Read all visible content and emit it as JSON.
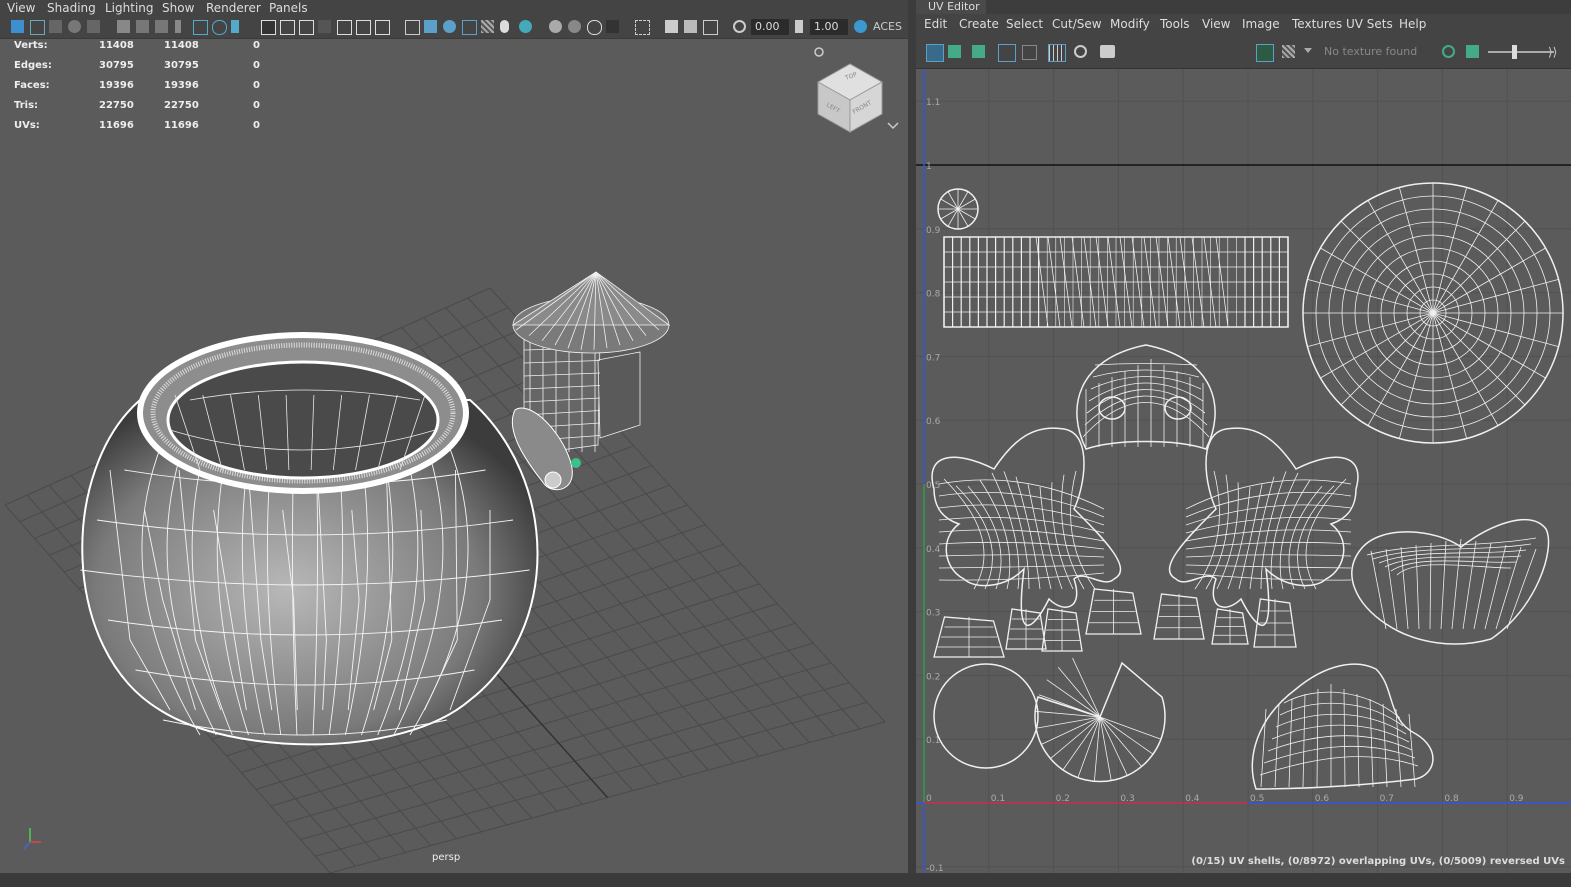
{
  "viewport": {
    "menu": [
      "View",
      "Shading",
      "Lighting",
      "Show",
      "Renderer",
      "Panels"
    ],
    "toolbar": {
      "exposure": "0.00",
      "gamma": "1.00",
      "color_space": "ACES"
    },
    "hud": {
      "rows": [
        {
          "label": "Verts:",
          "a": "11408",
          "b": "11408",
          "c": "0"
        },
        {
          "label": "Edges:",
          "a": "30795",
          "b": "30795",
          "c": "0"
        },
        {
          "label": "Faces:",
          "a": "19396",
          "b": "19396",
          "c": "0"
        },
        {
          "label": "Tris:",
          "a": "22750",
          "b": "22750",
          "c": "0"
        },
        {
          "label": "UVs:",
          "a": "11696",
          "b": "11696",
          "c": "0"
        }
      ]
    },
    "viewcube": {
      "top": "TOP",
      "left": "LEFT",
      "front": "FRONT"
    },
    "camera_label": "persp"
  },
  "uv_editor": {
    "tab_title": "UV Editor",
    "menu": [
      "Edit",
      "Create",
      "Select",
      "Cut/Sew",
      "Modify",
      "Tools",
      "View",
      "Image",
      "Textures",
      "UV Sets",
      "Help"
    ],
    "texture_placeholder": "No texture found",
    "axis_x": [
      "0",
      "0.1",
      "0.2",
      "0.3",
      "0.4",
      "0.5",
      "0.6",
      "0.7",
      "0.8",
      "0.9"
    ],
    "axis_y": [
      "1.1",
      "1",
      "0.9",
      "0.8",
      "0.7",
      "0.6",
      "0.5",
      "0.4",
      "0.3",
      "0.2",
      "0.1",
      "-0.1"
    ],
    "status": "(0/15) UV shells, (0/8972) overlapping UVs, (0/5009) reversed UVs"
  },
  "colors": {
    "accent": "#5aa0c8",
    "x_axis": "#c83232",
    "y_axis": "#32a032"
  }
}
